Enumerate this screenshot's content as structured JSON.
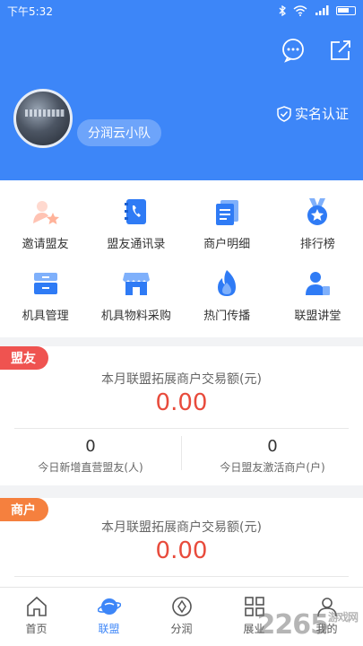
{
  "status": {
    "time": "下午5:32"
  },
  "profile": {
    "team_name": "分润云小队",
    "verify_label": "实名认证"
  },
  "menu": [
    {
      "label": "邀请盟友",
      "icon": "invite-icon"
    },
    {
      "label": "盟友通讯录",
      "icon": "phonebook-icon"
    },
    {
      "label": "商户明细",
      "icon": "merchant-detail-icon"
    },
    {
      "label": "排行榜",
      "icon": "ranking-medal-icon"
    },
    {
      "label": "机具管理",
      "icon": "device-manage-icon"
    },
    {
      "label": "机具物料采购",
      "icon": "store-icon"
    },
    {
      "label": "热门传播",
      "icon": "fire-icon"
    },
    {
      "label": "联盟讲堂",
      "icon": "lecture-icon"
    }
  ],
  "ally_card": {
    "tag": "盟友",
    "title": "本月联盟拓展商户交易额(元)",
    "amount": "0.00",
    "left_num": "0",
    "left_cap": "今日新增直营盟友(人)",
    "right_num": "0",
    "right_cap": "今日盟友激活商户(户)"
  },
  "merchant_card": {
    "tag": "商户",
    "title": "本月联盟拓展商户交易额(元)",
    "amount": "0.00"
  },
  "tabs": [
    {
      "label": "首页"
    },
    {
      "label": "联盟"
    },
    {
      "label": "分润"
    },
    {
      "label": "展业"
    },
    {
      "label": "我的"
    }
  ],
  "watermark": {
    "text": "2265",
    "sub": "游戏网"
  },
  "colors": {
    "brand": "#3d86f8",
    "ally_tag": "#ef5350",
    "merchant_tag": "#f5803e",
    "amount": "#e84b3c"
  }
}
